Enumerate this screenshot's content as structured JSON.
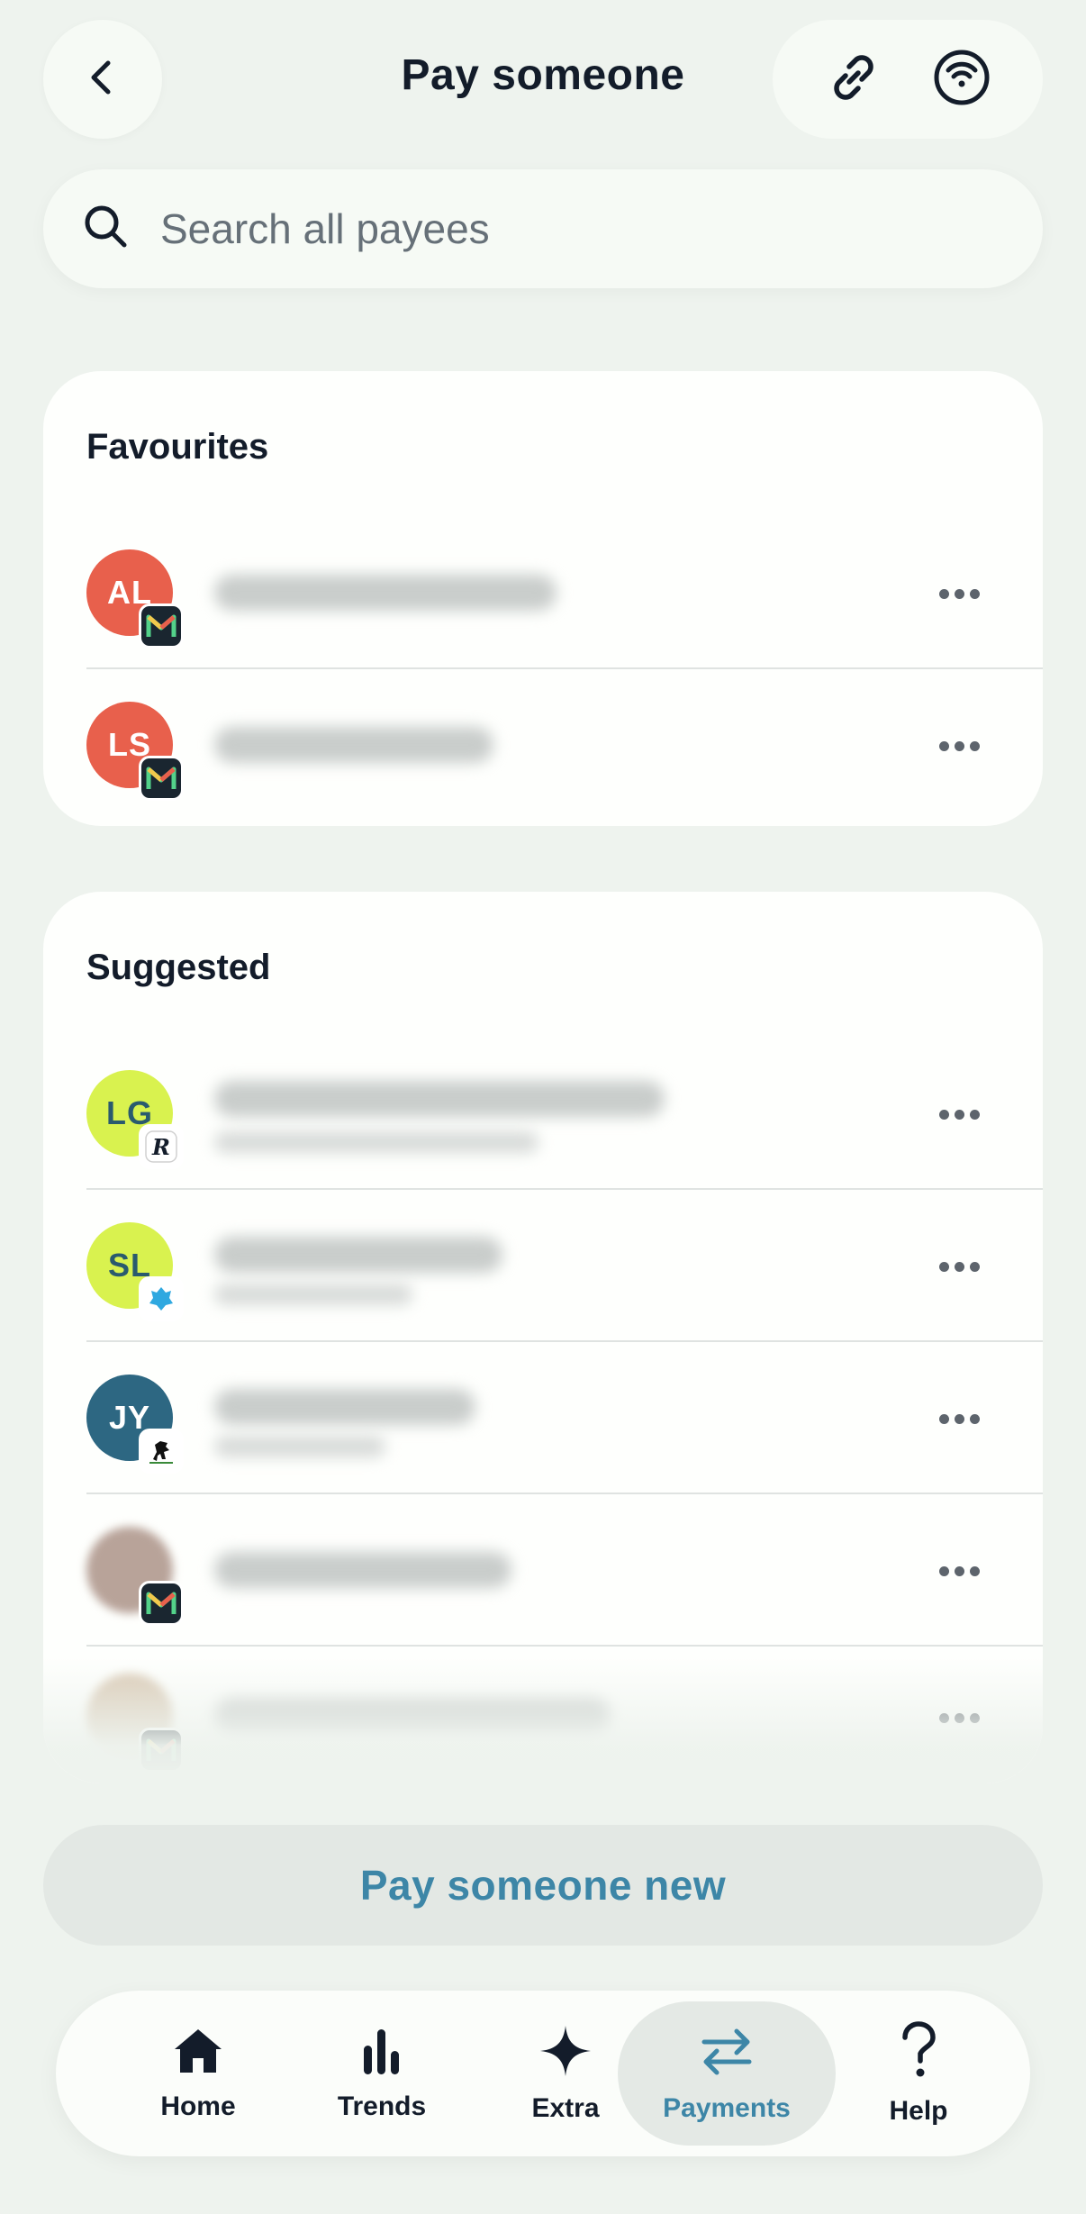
{
  "header": {
    "title": "Pay someone",
    "back_icon": "chevron-left-icon",
    "link_icon": "link-icon",
    "contactless_icon": "contactless-request-icon"
  },
  "search": {
    "placeholder": "Search all payees",
    "value": ""
  },
  "favourites": {
    "title": "Favourites",
    "items": [
      {
        "initials": "AL",
        "avatar_color": "#e8604c",
        "initials_color": "#ffffff",
        "bank": "monzo"
      },
      {
        "initials": "LS",
        "avatar_color": "#e8604c",
        "initials_color": "#ffffff",
        "bank": "monzo"
      }
    ]
  },
  "suggested": {
    "title": "Suggested",
    "items": [
      {
        "initials": "LG",
        "avatar_color": "#d9f24f",
        "initials_color": "#2a5a6e",
        "bank": "revolut"
      },
      {
        "initials": "SL",
        "avatar_color": "#d9f24f",
        "initials_color": "#2a5a6e",
        "bank": "barclays"
      },
      {
        "initials": "JY",
        "avatar_color": "#2d6782",
        "initials_color": "#ffffff",
        "bank": "lloyds"
      },
      {
        "initials": "",
        "avatar_color": "#b8a399",
        "initials_color": "#ffffff",
        "bank": "monzo"
      },
      {
        "initials": "",
        "avatar_color": "#d9c9b4",
        "initials_color": "#ffffff",
        "bank": "monzo"
      }
    ]
  },
  "pay_new": {
    "label": "Pay someone new"
  },
  "nav": {
    "items": [
      {
        "label": "Home",
        "icon": "home-icon",
        "active": false
      },
      {
        "label": "Trends",
        "icon": "bar-chart-icon",
        "active": false
      },
      {
        "label": "Extra",
        "icon": "sparkle-icon",
        "active": false
      },
      {
        "label": "Payments",
        "icon": "transfer-arrows-icon",
        "active": true
      },
      {
        "label": "Help",
        "icon": "help-icon",
        "active": false
      }
    ]
  },
  "colors": {
    "background": "#eef3ee",
    "accent": "#3d86a7",
    "card": "#fefffd"
  }
}
